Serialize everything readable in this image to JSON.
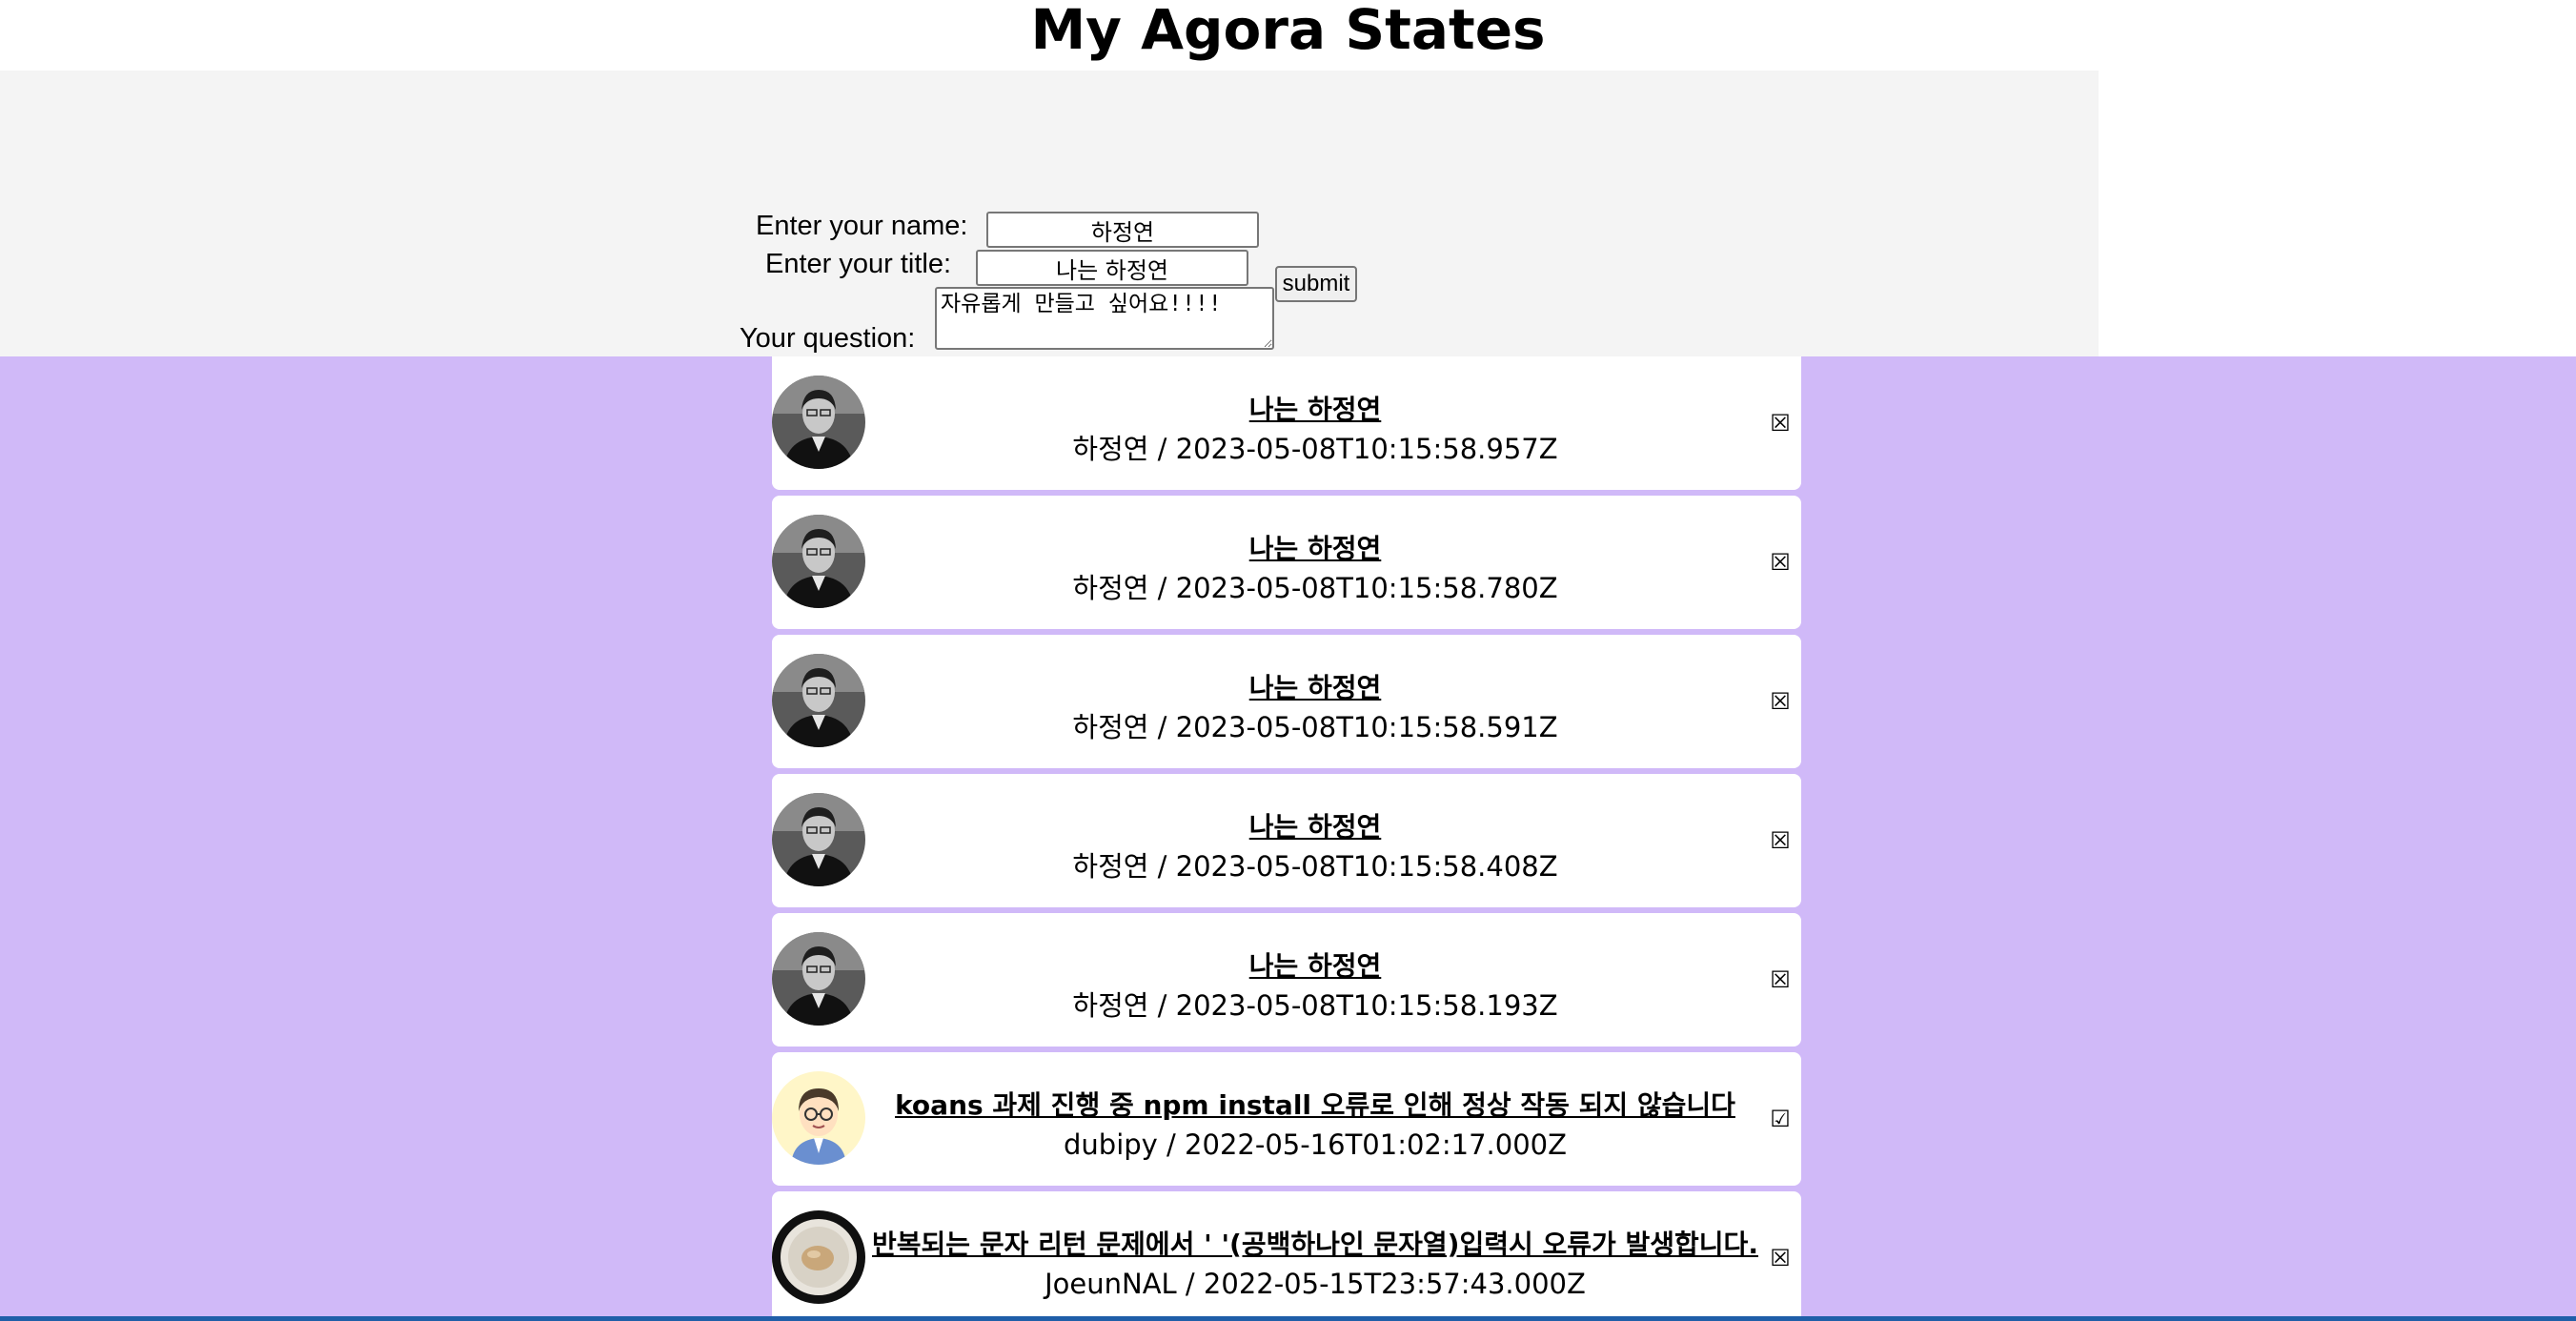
{
  "page": {
    "title": "My Agora States",
    "colors": {
      "form_bg": "#f4f4f4",
      "list_bg": "#d0b9f8",
      "card_bg": "#ffffff",
      "bottom_bar": "#1f5ea8"
    }
  },
  "form": {
    "name_label": "Enter your name:",
    "name_value": "하정연",
    "title_label": "Enter your title:",
    "title_value": "나는 하정연",
    "question_label": "Your question:",
    "question_value": "자유롭게 만들고 싶어요!!!!",
    "submit_label": "submit"
  },
  "discussions": [
    {
      "title": "나는 하정연",
      "author": "하정연",
      "created_at": "2023-05-08T10:15:58.957Z",
      "info": "하정연 / 2023-05-08T10:15:58.957Z",
      "answered": "☒",
      "avatar_icon": "man-photo-avatar-icon"
    },
    {
      "title": "나는 하정연",
      "author": "하정연",
      "created_at": "2023-05-08T10:15:58.780Z",
      "info": "하정연 / 2023-05-08T10:15:58.780Z",
      "answered": "☒",
      "avatar_icon": "man-photo-avatar-icon"
    },
    {
      "title": "나는 하정연",
      "author": "하정연",
      "created_at": "2023-05-08T10:15:58.591Z",
      "info": "하정연 / 2023-05-08T10:15:58.591Z",
      "answered": "☒",
      "avatar_icon": "man-photo-avatar-icon"
    },
    {
      "title": "나는 하정연",
      "author": "하정연",
      "created_at": "2023-05-08T10:15:58.408Z",
      "info": "하정연 / 2023-05-08T10:15:58.408Z",
      "answered": "☒",
      "avatar_icon": "man-photo-avatar-icon"
    },
    {
      "title": "나는 하정연",
      "author": "하정연",
      "created_at": "2023-05-08T10:15:58.193Z",
      "info": "하정연 / 2023-05-08T10:15:58.193Z",
      "answered": "☒",
      "avatar_icon": "man-photo-avatar-icon"
    },
    {
      "title": "koans 과제 진행 중 npm install 오류로 인해 정상 작동 되지 않습니다",
      "author": "dubipy",
      "created_at": "2022-05-16T01:02:17.000Z",
      "info": "dubipy / 2022-05-16T01:02:17.000Z",
      "answered": "☑",
      "avatar_icon": "cartoon-man-avatar-icon"
    },
    {
      "title": "반복되는 문자 리턴 문제에서 ' '(공백하나인 문자열)입력시 오류가 발생합니다.",
      "author": "JoeunNAL",
      "created_at": "2022-05-15T23:57:43.000Z",
      "info": "JoeunNAL / 2022-05-15T23:57:43.000Z",
      "answered": "☒",
      "avatar_icon": "plate-food-avatar-icon"
    }
  ]
}
